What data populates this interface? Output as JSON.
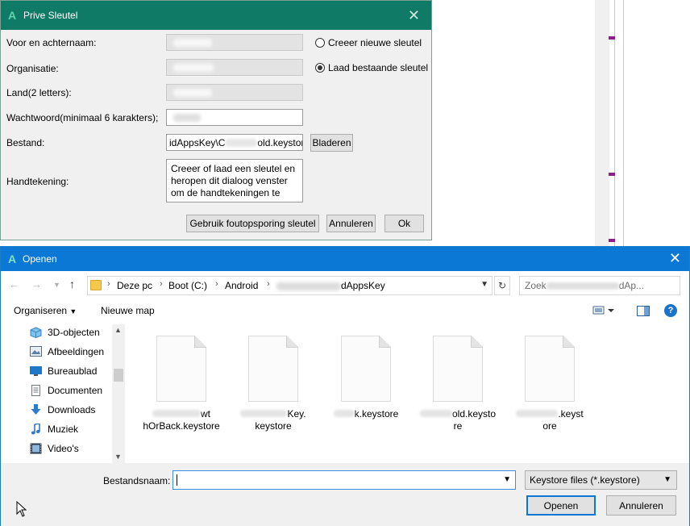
{
  "prive_dialog": {
    "title": "Prive Sleutel",
    "labels": {
      "name": "Voor en achternaam:",
      "org": "Organisatie:",
      "country": "Land(2 letters):",
      "password": "Wachtwoord(minimaal 6 karakters);",
      "file": "Bestand:",
      "signature": "Handtekening:"
    },
    "file_value_prefix": "idAppsKey\\C",
    "file_value_suffix": "old.keystore",
    "browse_button": "Bladeren",
    "radio_new": "Creeer nieuwe sleutel",
    "radio_load": "Laad bestaande sleutel",
    "signature_text": "Creeer of laad een sleutel en heropen dit dialoog venster om de handtekeningen te",
    "debug_button": "Gebruik foutopsporing sleutel",
    "cancel_button": "Annuleren",
    "ok_button": "Ok"
  },
  "open_dialog": {
    "title": "Openen",
    "breadcrumb": [
      "Deze pc",
      "Boot (C:)",
      "Android",
      "dAppsKey"
    ],
    "search_placeholder": "Zoek",
    "search_suffix": "dAp...",
    "organize": "Organiseren",
    "new_folder": "Nieuwe map",
    "nav_items": [
      {
        "label": "3D-objecten",
        "icon": "cube-icon"
      },
      {
        "label": "Afbeeldingen",
        "icon": "pictures-icon"
      },
      {
        "label": "Bureaublad",
        "icon": "desktop-icon"
      },
      {
        "label": "Documenten",
        "icon": "documents-icon"
      },
      {
        "label": "Downloads",
        "icon": "download-icon"
      },
      {
        "label": "Muziek",
        "icon": "music-icon"
      },
      {
        "label": "Video's",
        "icon": "video-icon"
      }
    ],
    "files": [
      {
        "line1": "wt",
        "line2": "hOrBack.keystore"
      },
      {
        "line1": "Key.",
        "line2": "keystore"
      },
      {
        "line1": "k.keystore",
        "line2": ""
      },
      {
        "line1": "old.keysto",
        "line2": "re"
      },
      {
        "line1": ".keyst",
        "line2": "ore"
      }
    ],
    "filename_label": "Bestandsnaam:",
    "filename_value": "",
    "filter": "Keystore files (*.keystore)",
    "open_button": "Openen",
    "cancel_button": "Annuleren"
  },
  "colors": {
    "prive_title_bg": "#0f7a66",
    "open_title_bg": "#0a78d4",
    "accent": "#0a78d4"
  }
}
